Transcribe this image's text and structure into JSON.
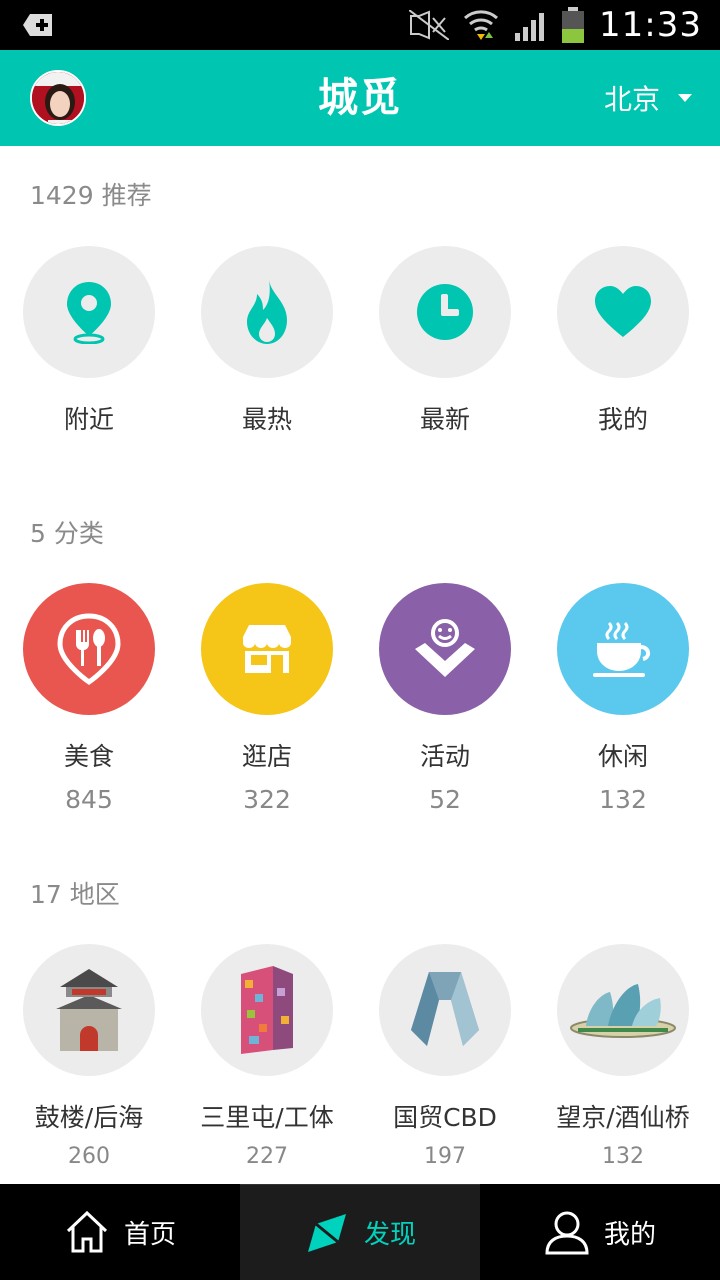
{
  "status_bar": {
    "time": "11:33"
  },
  "header": {
    "logo": "城觅",
    "city": "北京"
  },
  "recommend": {
    "title": "1429 推荐",
    "items": [
      {
        "label": "附近",
        "icon": "location-pin-icon"
      },
      {
        "label": "最热",
        "icon": "flame-icon"
      },
      {
        "label": "最新",
        "icon": "clock-icon"
      },
      {
        "label": "我的",
        "icon": "heart-icon"
      }
    ],
    "accent": "#00c5b0"
  },
  "categories": {
    "title": "5 分类",
    "items": [
      {
        "label": "美食",
        "count": "845",
        "color": "#e8564f",
        "icon": "fork-spoon-icon"
      },
      {
        "label": "逛店",
        "count": "322",
        "color": "#f5c518",
        "icon": "shop-icon"
      },
      {
        "label": "活动",
        "count": "52",
        "color": "#8a61a8",
        "icon": "smile-hands-icon"
      },
      {
        "label": "休闲",
        "count": "132",
        "color": "#5bc8ee",
        "icon": "coffee-cup-icon"
      }
    ]
  },
  "districts": {
    "title": "17 地区",
    "items": [
      {
        "label": "鼓楼/后海",
        "count": "260",
        "icon": "drum-tower-icon"
      },
      {
        "label": "三里屯/工体",
        "count": "227",
        "icon": "sanlitun-building-icon"
      },
      {
        "label": "国贸CBD",
        "count": "197",
        "icon": "cctv-tower-icon"
      },
      {
        "label": "望京/酒仙桥",
        "count": "132",
        "icon": "wangjing-soho-icon"
      }
    ]
  },
  "bottom_nav": {
    "items": [
      {
        "label": "首页",
        "icon": "home-icon"
      },
      {
        "label": "发现",
        "icon": "compass-icon"
      },
      {
        "label": "我的",
        "icon": "user-icon"
      }
    ],
    "active_color": "#00d3bd"
  }
}
